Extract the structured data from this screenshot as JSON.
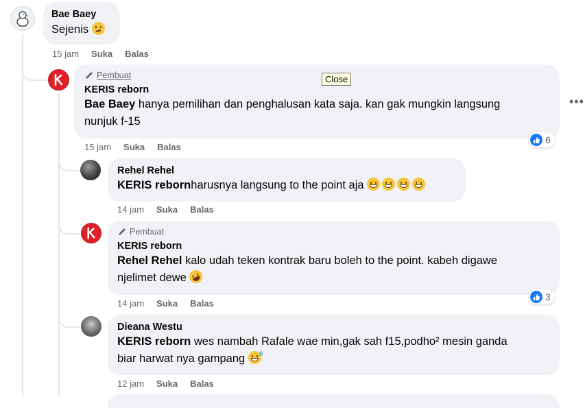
{
  "comments": [
    {
      "author": "Bae Baey",
      "text": "Sejenis",
      "emoji": "thinking-face",
      "time": "15 jam",
      "like": "Suka",
      "reply": "Balas"
    },
    {
      "badge": "Pembuat",
      "author": "KERIS reborn",
      "mention": "Bae Baey",
      "text_line1": " hanya pemilihan dan penghalusan kata saja. kan gak mungkin langsung",
      "text_line2": "nunjuk f-15",
      "time": "15 jam",
      "like": "Suka",
      "reply": "Balas",
      "reactions": "6"
    },
    {
      "author": "Rehel Rehel",
      "mention": "KERIS reborn",
      "text": "harusnya langsung to the point aja",
      "emoji": "grinning-face-x4",
      "time": "14 jam",
      "like": "Suka",
      "reply": "Balas"
    },
    {
      "badge": "Pembuat",
      "author": "KERIS reborn",
      "mention": "Rehel Rehel",
      "text_line1": " kalo udah teken kontrak baru boleh to the point. kabeh digawe",
      "text_line2": "njelimet dewe",
      "emoji": "rolling-laughing-face",
      "time": "14 jam",
      "like": "Suka",
      "reply": "Balas",
      "reactions": "3"
    },
    {
      "author": "Dieana Westu",
      "mention": "KERIS reborn",
      "text_line1": " wes nambah Rafale wae min,gak sah f15,podho² mesin ganda",
      "text_line2": "biar harwat nya gampang",
      "emoji": "grinning-sweat-face",
      "time": "12 jam",
      "like": "Suka",
      "reply": "Balas"
    }
  ],
  "tooltip": "Close",
  "more_menu": "•••",
  "colors": {
    "bubble": "#f0f2f5",
    "meta": "#65676b",
    "like_blue": "#1877f2",
    "keris_red": "#e02028"
  }
}
